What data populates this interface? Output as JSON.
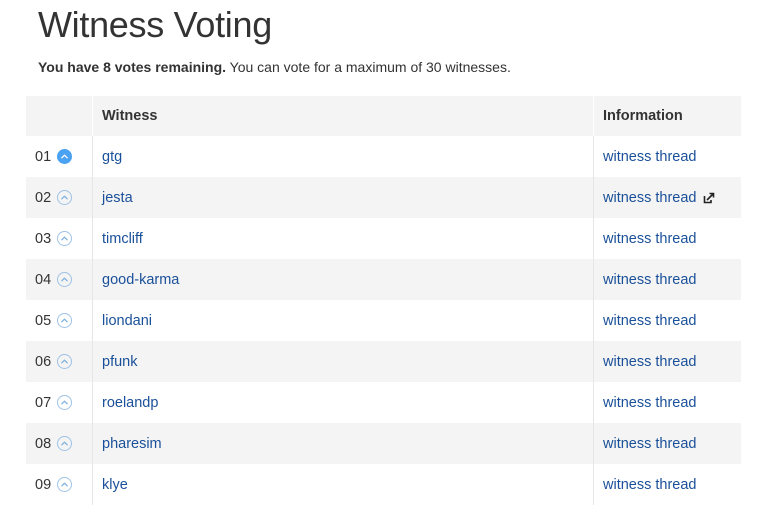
{
  "page": {
    "title": "Witness Voting",
    "subtitle_bold": "You have 8 votes remaining.",
    "subtitle_rest": " You can vote for a maximum of 30 witnesses."
  },
  "table": {
    "headers": {
      "rank": "",
      "witness": "Witness",
      "information": "Information"
    },
    "rows": [
      {
        "rank": "01",
        "witness": "gtg",
        "info": "witness thread",
        "voted": true,
        "external": false
      },
      {
        "rank": "02",
        "witness": "jesta",
        "info": "witness thread",
        "voted": false,
        "external": true
      },
      {
        "rank": "03",
        "witness": "timcliff",
        "info": "witness thread",
        "voted": false,
        "external": false
      },
      {
        "rank": "04",
        "witness": "good-karma",
        "info": "witness thread",
        "voted": false,
        "external": false
      },
      {
        "rank": "05",
        "witness": "liondani",
        "info": "witness thread",
        "voted": false,
        "external": false
      },
      {
        "rank": "06",
        "witness": "pfunk",
        "info": "witness thread",
        "voted": false,
        "external": false
      },
      {
        "rank": "07",
        "witness": "roelandp",
        "info": "witness thread",
        "voted": false,
        "external": false
      },
      {
        "rank": "08",
        "witness": "pharesim",
        "info": "witness thread",
        "voted": false,
        "external": false
      },
      {
        "rank": "09",
        "witness": "klye",
        "info": "witness thread",
        "voted": false,
        "external": false
      }
    ]
  },
  "icons": {
    "vote": "chevron-up-icon",
    "external": "external-link-icon"
  },
  "colors": {
    "link": "#1a5099",
    "vote_active": "#4ba2f2",
    "vote_border": "#9ec2e6",
    "row_alt": "#f4f4f4"
  }
}
